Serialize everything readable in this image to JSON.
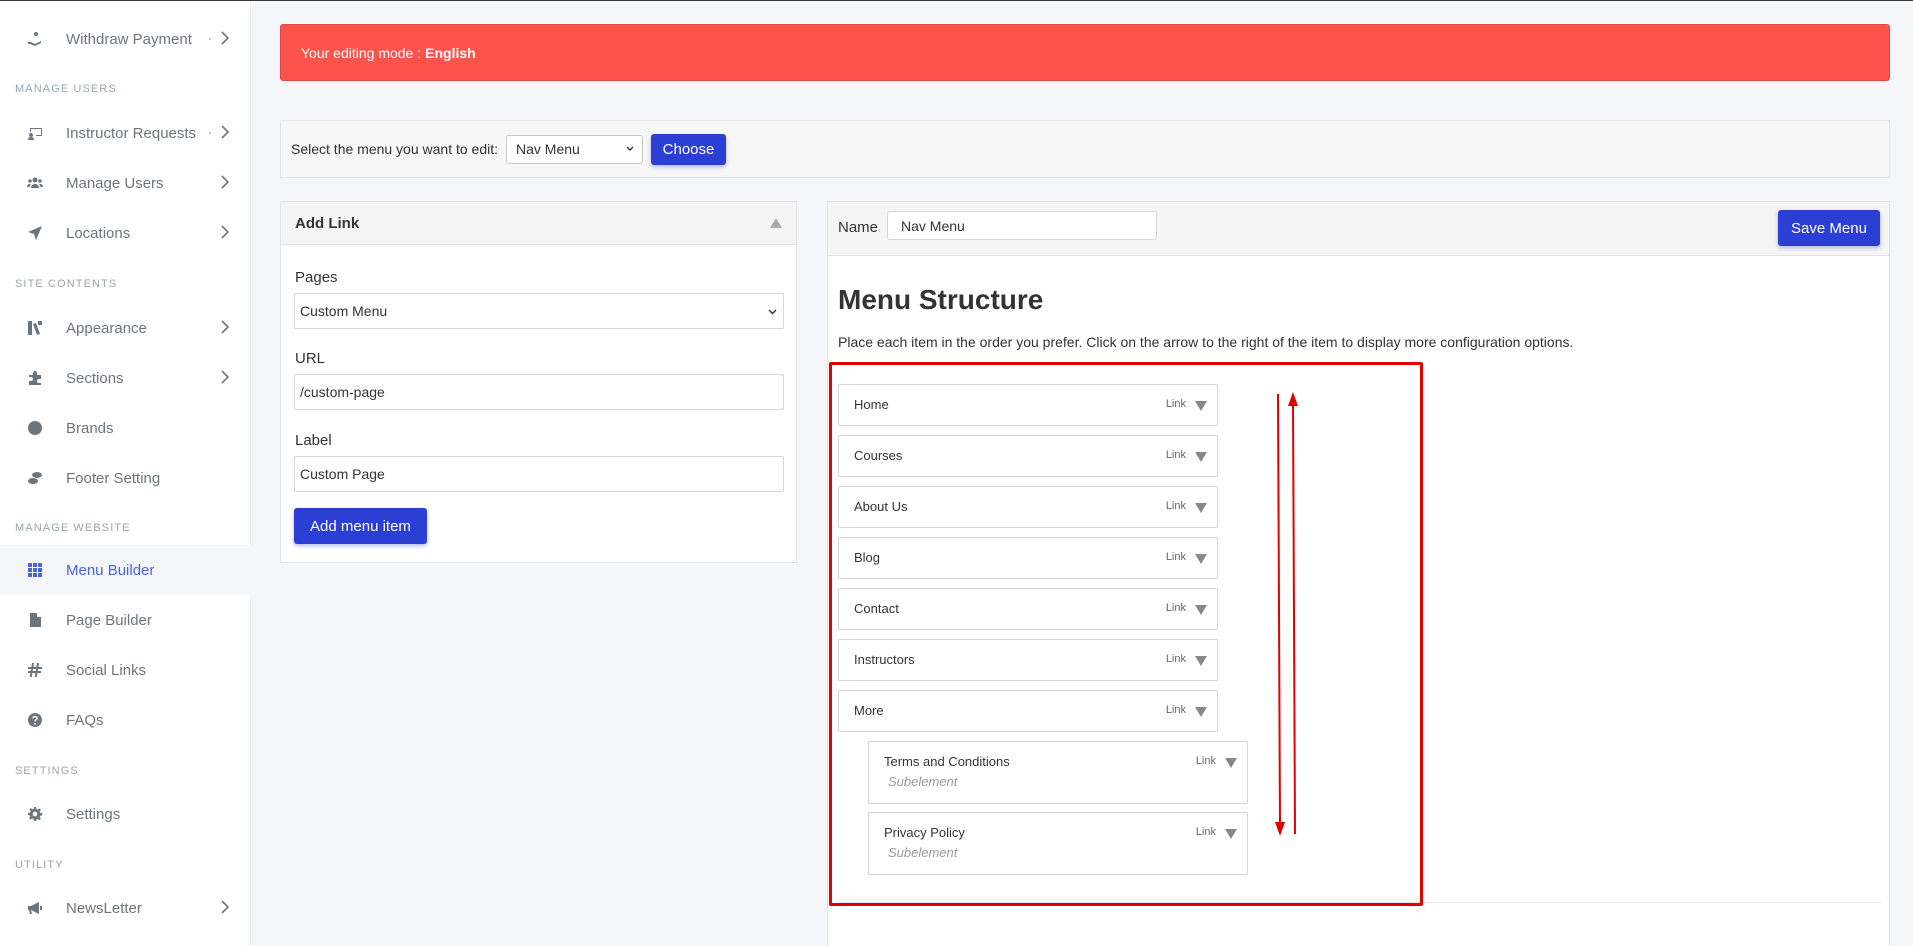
{
  "sidebar": {
    "items": [
      {
        "label": "Withdraw Payment",
        "icon": "hand-coin-icon"
      },
      {
        "label": "Instructor Requests",
        "icon": "chalkboard-user-icon"
      },
      {
        "label": "Manage Users",
        "icon": "users-icon"
      },
      {
        "label": "Locations",
        "icon": "location-arrow-icon"
      },
      {
        "label": "Appearance",
        "icon": "palette-icon"
      },
      {
        "label": "Sections",
        "icon": "puzzle-icon"
      },
      {
        "label": "Brands",
        "icon": "copyright-icon"
      },
      {
        "label": "Footer Setting",
        "icon": "shoe-print-icon"
      },
      {
        "label": "Menu Builder",
        "icon": "grid-icon"
      },
      {
        "label": "Page Builder",
        "icon": "file-icon"
      },
      {
        "label": "Social Links",
        "icon": "hashtag-icon"
      },
      {
        "label": "FAQs",
        "icon": "question-circle-icon"
      },
      {
        "label": "Settings",
        "icon": "gear-icon"
      },
      {
        "label": "NewsLetter",
        "icon": "megaphone-icon"
      }
    ],
    "headings": [
      "MANAGE USERS",
      "SITE CONTENTS",
      "MANAGE WEBSITE",
      "SETTINGS",
      "UTILITY"
    ],
    "active_item": "Menu Builder",
    "accent_color": "#4a63d8"
  },
  "alert": {
    "prefix": "Your editing mode :",
    "language": "English",
    "color": "#fc544b"
  },
  "menu_select": {
    "label": "Select the menu you want to edit:",
    "selected": "Nav Menu",
    "choose_label": "Choose"
  },
  "add_link": {
    "title": "Add Link",
    "pages_label": "Pages",
    "pages_value": "Custom Menu",
    "url_label": "URL",
    "url_value": "/custom-page",
    "label_label": "Label",
    "label_value": "Custom Page",
    "add_button": "Add menu item"
  },
  "menu_editor": {
    "name_label": "Name",
    "name_value": "Nav Menu",
    "save_button": "Save Menu",
    "title": "Menu Structure",
    "description": "Place each item in the order you prefer. Click on the arrow to the right of the item to display more configuration options.",
    "items": [
      {
        "title": "Home",
        "type": "Link"
      },
      {
        "title": "Courses",
        "type": "Link"
      },
      {
        "title": "About Us",
        "type": "Link"
      },
      {
        "title": "Blog",
        "type": "Link"
      },
      {
        "title": "Contact",
        "type": "Link"
      },
      {
        "title": "Instructors",
        "type": "Link"
      },
      {
        "title": "More",
        "type": "Link"
      }
    ],
    "sub_items": [
      {
        "title": "Terms and Conditions",
        "type": "Link",
        "note": "Subelement"
      },
      {
        "title": "Privacy Policy",
        "type": "Link",
        "note": "Subelement"
      }
    ]
  },
  "colors": {
    "primary_button": "#2c3fd4",
    "annotation_red": "#e00000"
  }
}
